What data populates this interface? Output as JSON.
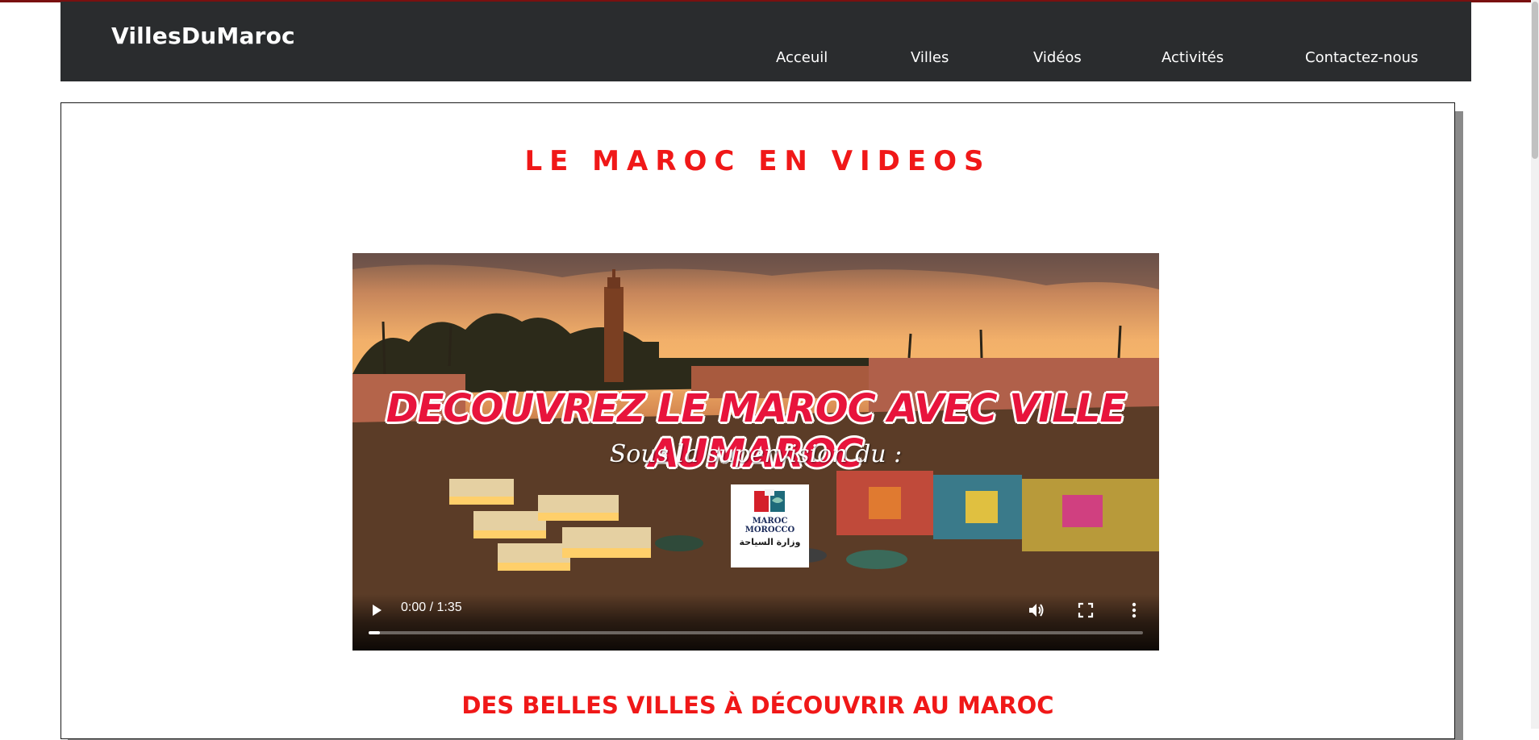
{
  "brand": "VillesDuMaroc",
  "nav": {
    "items": [
      "Acceuil",
      "Villes",
      "Vidéos",
      "Activités",
      "Contactez-nous"
    ]
  },
  "page_title": "LE MAROC EN VIDEOS",
  "video": {
    "headline": "DECOUVREZ LE MAROC AVEC VILLE AUMAROC",
    "subline": "Sous la supervision du :",
    "logo": {
      "line1": "MAROC",
      "line2": "MOROCCO",
      "arabic": "وزارة السياحة"
    },
    "time": "0:00 / 1:35",
    "progress": 0.015
  },
  "section_title": "DES BELLES VILLES À DÉCOUVRIR AU MAROC",
  "colors": {
    "accent_red": "#f01818",
    "navbar": "#2a2c2e",
    "top_accent": "#7a1010"
  }
}
